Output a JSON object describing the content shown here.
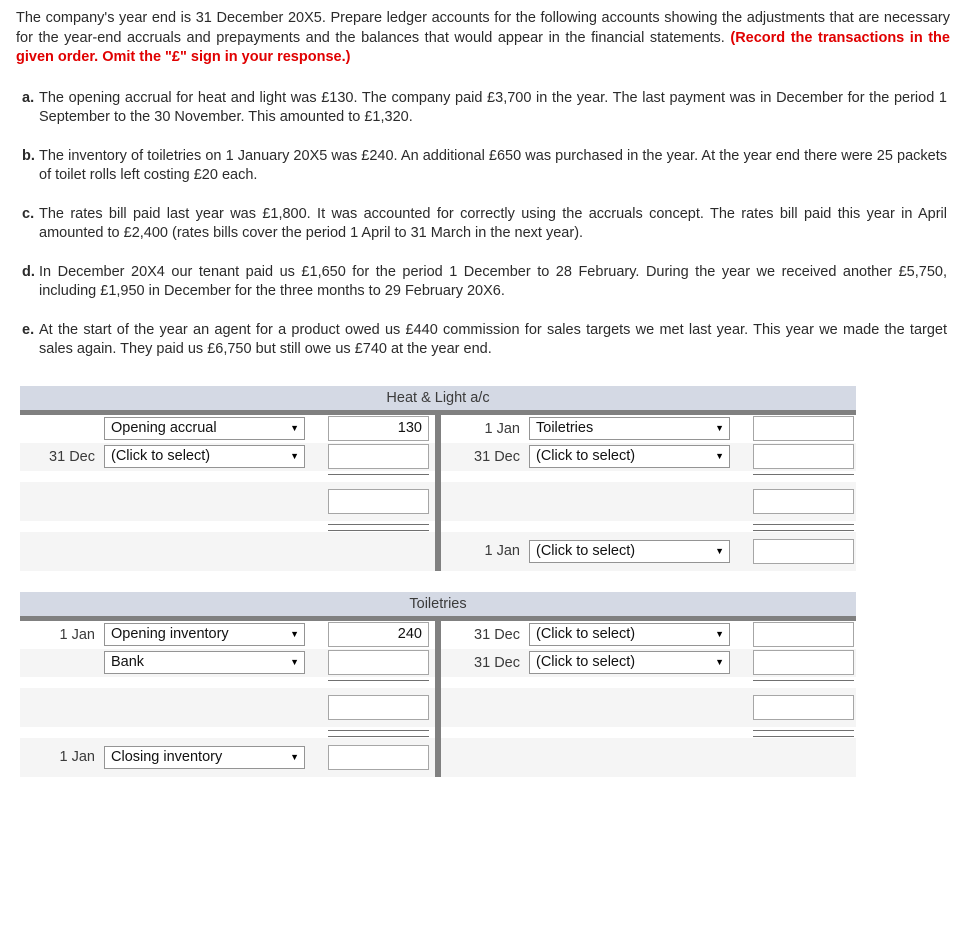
{
  "intro": {
    "text_part1": "The company's year end is 31 December 20X5. Prepare ledger accounts for the following accounts showing the adjustments that are necessary for the year-end accruals and prepayments and the balances that would appear in the financial statements. ",
    "text_bold_red": "(Record the transactions in the given order. Omit the \"£\" sign in your response.)"
  },
  "items": [
    {
      "letter": "a.",
      "text": "The opening accrual for heat and light was £130. The company paid £3,700 in the year. The last payment was in December for the period 1 September to the 30 November. This amounted to £1,320."
    },
    {
      "letter": "b.",
      "text": "The inventory of toiletries on 1 January 20X5 was £240. An additional £650 was purchased in the year. At the year end there were 25 packets of toilet rolls left costing £20 each."
    },
    {
      "letter": "c.",
      "text": "The rates bill paid last year was £1,800. It was accounted for correctly using the accruals concept. The rates bill paid this year in April amounted to £2,400 (rates bills cover the period 1 April to 31 March in the next year)."
    },
    {
      "letter": "d.",
      "text": "In December 20X4 our tenant paid us £1,650 for the period 1 December to 28 February. During the year we received another £5,750, including £1,950 in December for the three months to 29 February 20X6."
    },
    {
      "letter": "e.",
      "text": "At the start of the year an agent for a product owed us £440 commission for sales targets we met last year. This year we made the target sales again. They paid us £6,750 but still owe us £740 at the year end."
    }
  ],
  "placeholder_select": "(Click to select)",
  "caret_glyph": "▼",
  "ledgers": [
    {
      "title": "Heat & Light a/c",
      "left": {
        "rows": [
          {
            "date": "",
            "select": "Opening accrual",
            "amount": "130"
          },
          {
            "date": "31 Dec",
            "select": "(Click to select)",
            "amount": ""
          }
        ],
        "total_amount": "",
        "closing": null
      },
      "right": {
        "rows": [
          {
            "date": "1 Jan",
            "select": "Toiletries",
            "amount": ""
          },
          {
            "date": "31 Dec",
            "select": "(Click to select)",
            "amount": ""
          }
        ],
        "total_amount": "",
        "closing": {
          "date": "1 Jan",
          "select": "(Click to select)",
          "amount": ""
        }
      }
    },
    {
      "title": "Toiletries",
      "left": {
        "rows": [
          {
            "date": "1 Jan",
            "select": "Opening inventory",
            "amount": "240"
          },
          {
            "date": "",
            "select": "Bank",
            "amount": ""
          }
        ],
        "total_amount": "",
        "closing": {
          "date": "1 Jan",
          "select": "Closing inventory",
          "amount": ""
        }
      },
      "right": {
        "rows": [
          {
            "date": "31 Dec",
            "select": "(Click to select)",
            "amount": ""
          },
          {
            "date": "31 Dec",
            "select": "(Click to select)",
            "amount": ""
          }
        ],
        "total_amount": "",
        "closing": null
      }
    }
  ],
  "colors": {
    "header_bar": "#d4d9e4",
    "rule": "#808080",
    "accent_red": "#e00000",
    "row_shade": "#f5f5f5"
  }
}
